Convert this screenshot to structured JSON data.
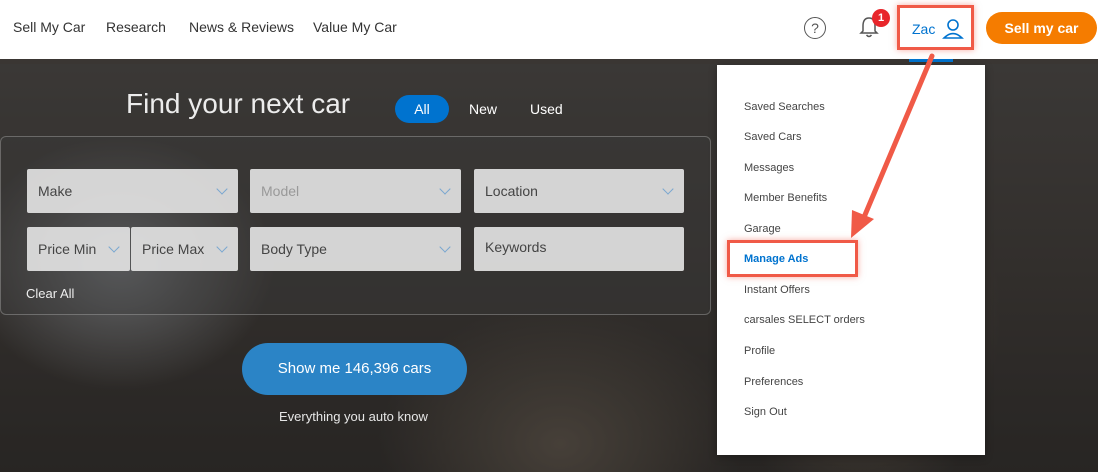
{
  "nav": {
    "links": [
      "Sell My Car",
      "Research",
      "News & Reviews",
      "Value My Car"
    ],
    "help_icon": "?",
    "notification_count": "1",
    "user_name": "Zac",
    "sell_button": "Sell my car"
  },
  "hero": {
    "title": "Find your next car",
    "tabs": [
      "All",
      "New",
      "Used"
    ],
    "filters": {
      "make": "Make",
      "model": "Model",
      "location": "Location",
      "price_min": "Price Min",
      "price_max": "Price Max",
      "body_type": "Body Type",
      "keywords": "Keywords"
    },
    "clear_all": "Clear All",
    "show_button": "Show me 146,396 cars",
    "tagline": "Everything you auto know"
  },
  "menu": {
    "items": [
      "Saved Searches",
      "Saved Cars",
      "Messages",
      "Member Benefits",
      "Garage",
      "Manage Ads",
      "Instant Offers",
      "carsales SELECT orders",
      "Profile",
      "Preferences",
      "Sign Out"
    ],
    "active": "Manage Ads"
  },
  "colors": {
    "accent": "#0073cf",
    "sell_button": "#f57c00",
    "annotation": "#f05a47",
    "badge": "#e8262b"
  }
}
